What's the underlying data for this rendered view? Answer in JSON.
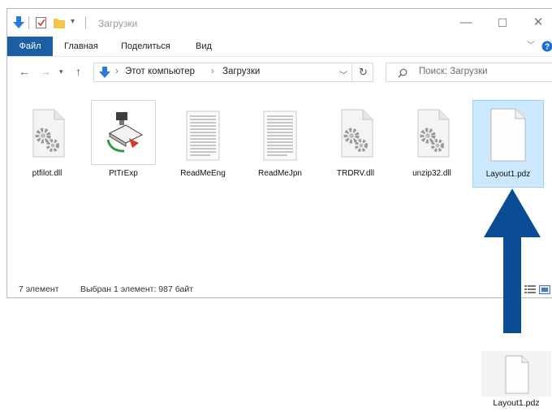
{
  "window": {
    "title": "Загрузки",
    "controls": {
      "minimize": "—",
      "maximize": "☐",
      "close": "✕"
    }
  },
  "ribbon": {
    "tabs": [
      {
        "label": "Файл"
      },
      {
        "label": "Главная"
      },
      {
        "label": "Поделиться"
      },
      {
        "label": "Вид"
      }
    ]
  },
  "address": {
    "crumbs": [
      "Этот компьютер",
      "Загрузки"
    ],
    "search_placeholder": "Поиск: Загрузки"
  },
  "files": [
    {
      "name": "ptfilot.dll",
      "icon": "dll-gear-icon"
    },
    {
      "name": "PtTrExp",
      "icon": "app-exe-icon"
    },
    {
      "name": "ReadMeEng",
      "icon": "text-document-icon"
    },
    {
      "name": "ReadMeJpn",
      "icon": "text-document-icon"
    },
    {
      "name": "TRDRV.dll",
      "icon": "dll-gear-icon"
    },
    {
      "name": "unzip32.dll",
      "icon": "dll-gear-icon"
    },
    {
      "name": "Layout1.pdz",
      "icon": "blank-file-icon",
      "selected": true
    }
  ],
  "status": {
    "count": "7 элемент",
    "selection": "Выбран 1 элемент: 987 байт"
  },
  "dragged_file": {
    "name": "Layout1.pdz",
    "icon": "blank-file-icon"
  },
  "colors": {
    "accent": "#1a5fa3",
    "selection": "#cce8ff",
    "arrow": "#0b4d94"
  }
}
